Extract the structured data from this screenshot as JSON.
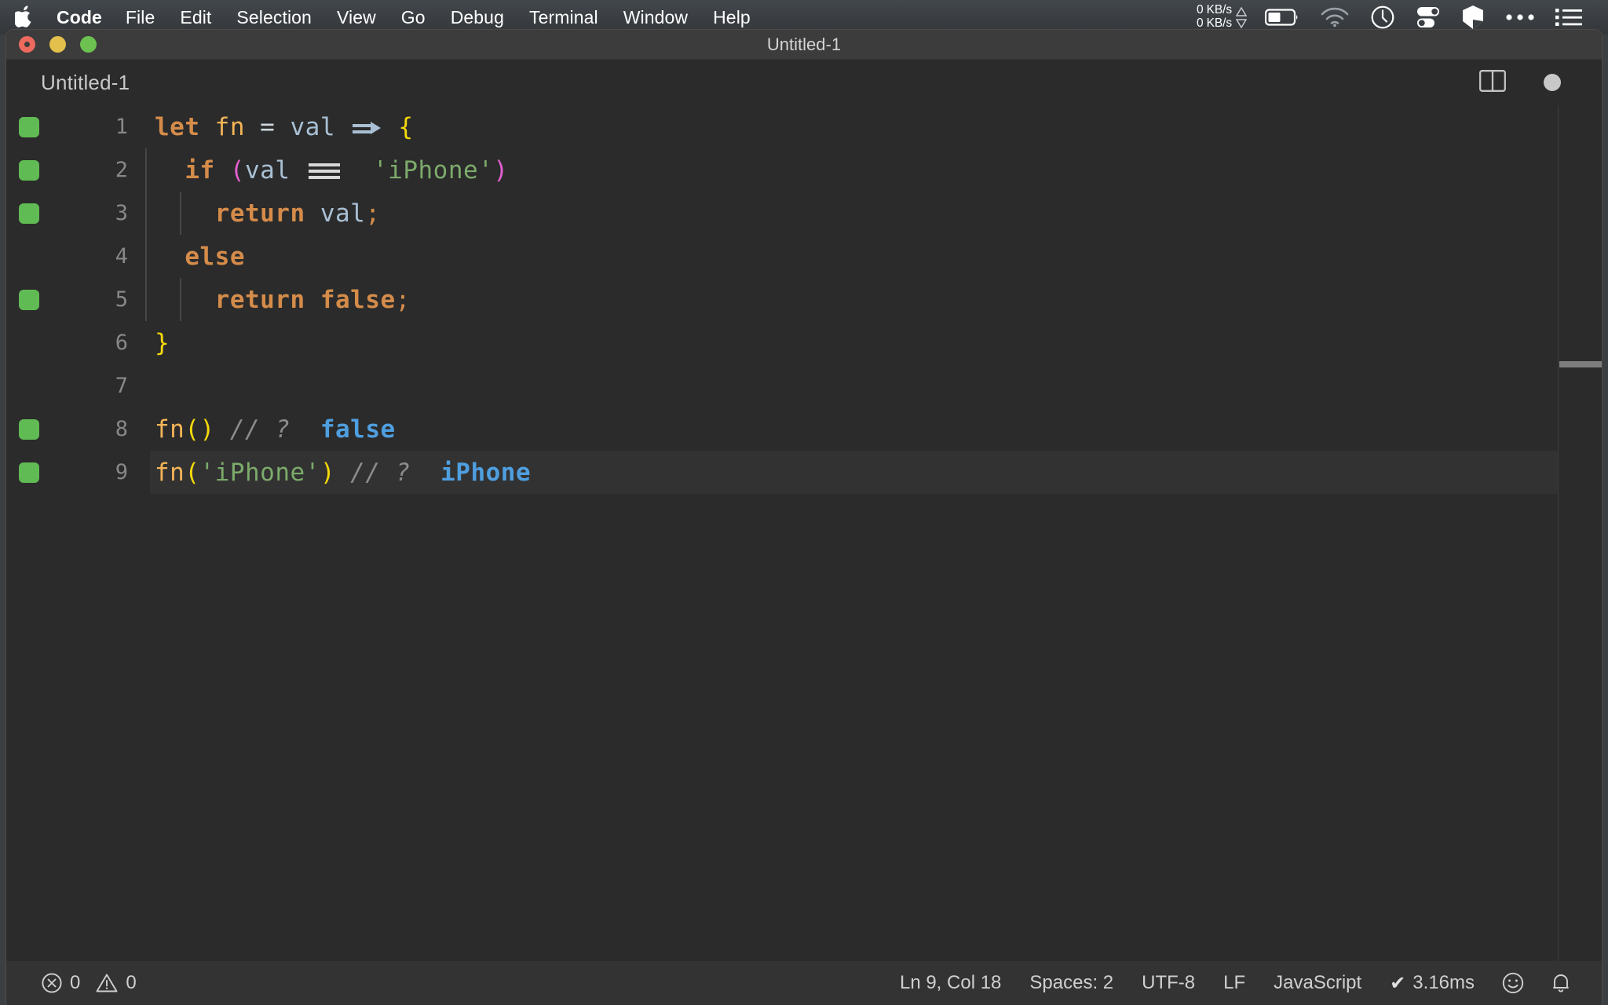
{
  "menubar": {
    "apple_icon": "apple-logo-icon",
    "items": [
      {
        "label": "Code",
        "bold": true
      },
      {
        "label": "File",
        "bold": false
      },
      {
        "label": "Edit",
        "bold": false
      },
      {
        "label": "Selection",
        "bold": false
      },
      {
        "label": "View",
        "bold": false
      },
      {
        "label": "Go",
        "bold": false
      },
      {
        "label": "Debug",
        "bold": false
      },
      {
        "label": "Terminal",
        "bold": false
      },
      {
        "label": "Window",
        "bold": false
      },
      {
        "label": "Help",
        "bold": false
      }
    ],
    "status_icons": {
      "network_up": "0 KB/s",
      "network_down": "0 KB/s",
      "battery": "battery-icon",
      "wifi": "wifi-icon",
      "clock": "clock-icon",
      "toggles": "toggles-icon",
      "shape": "cube-icon",
      "ellipsis": "ellipsis-icon",
      "list": "list-icon"
    }
  },
  "window": {
    "title": "Untitled-1",
    "traffic_lights": [
      "close-button",
      "minimize-button",
      "zoom-button"
    ]
  },
  "tabbar": {
    "tab_label": "Untitled-1",
    "split_editor_icon": "split-editor-icon",
    "dirty_indicator": "unsaved-changes-dot"
  },
  "editor": {
    "language": "JavaScript",
    "lines": [
      {
        "no": "1",
        "gutter": true,
        "active": false,
        "indent_guides": 0
      },
      {
        "no": "2",
        "gutter": true,
        "active": false,
        "indent_guides": 1
      },
      {
        "no": "3",
        "gutter": true,
        "active": false,
        "indent_guides": 2
      },
      {
        "no": "4",
        "gutter": false,
        "active": false,
        "indent_guides": 1
      },
      {
        "no": "5",
        "gutter": true,
        "active": false,
        "indent_guides": 2
      },
      {
        "no": "6",
        "gutter": false,
        "active": false,
        "indent_guides": 0
      },
      {
        "no": "7",
        "gutter": false,
        "active": false,
        "indent_guides": 0
      },
      {
        "no": "8",
        "gutter": true,
        "active": false,
        "indent_guides": 0
      },
      {
        "no": "9",
        "gutter": true,
        "active": true,
        "indent_guides": 0
      }
    ],
    "code": {
      "l1_let": "let",
      "l1_fn": "fn",
      "l1_eq": "=",
      "l1_val": "val",
      "l1_brace": "{",
      "l2_if": "if",
      "l2_paren_open": "(",
      "l2_val": "val",
      "l2_str": "'iPhone'",
      "l2_paren_close": ")",
      "l3_return": "return",
      "l3_val": "val",
      "l3_semi": ";",
      "l4_else": "else",
      "l5_return": "return",
      "l5_false": "false",
      "l5_semi": ";",
      "l6_brace": "}",
      "l7_empty": "",
      "l8_fn": "fn",
      "l8_paren_open": "(",
      "l8_paren_close": ")",
      "l8_comment": "// ?",
      "l8_result": "false",
      "l9_fn": "fn",
      "l9_paren_open": "(",
      "l9_str": "'iPhone'",
      "l9_paren_close": ")",
      "l9_comment": "// ?",
      "l9_result": "iPhone"
    },
    "ligatures": {
      "arrow": "=>",
      "strict_equals": "==="
    }
  },
  "statusbar": {
    "errors_icon": "error-circle-icon",
    "errors_count": "0",
    "warnings_icon": "warning-triangle-icon",
    "warnings_count": "0",
    "cursor_position": "Ln 9, Col 18",
    "indentation": "Spaces: 2",
    "encoding": "UTF-8",
    "eol": "LF",
    "language_mode": "JavaScript",
    "quokka_check": "✔",
    "quokka_time": "3.16ms",
    "feedback_icon": "smiley-icon",
    "notifications_icon": "bell-icon"
  },
  "colors": {
    "menubar_bg": "#3a3e42",
    "titlebar_bg": "#3c3c3c",
    "editor_bg": "#2b2b2b",
    "active_line_bg": "#323232",
    "statusbar_bg": "#333333",
    "gutter_marker": "#61bb54",
    "keyword": "#d58c4a",
    "function": "#f3b457",
    "variable": "#a9c0d4",
    "string": "#7cab6b",
    "brace_yellow": "#f5d90a",
    "paren_magenta": "#e35fd0",
    "comment": "#8c8c8c",
    "result_blue": "#4f9fe0",
    "linenumber": "#888888"
  }
}
